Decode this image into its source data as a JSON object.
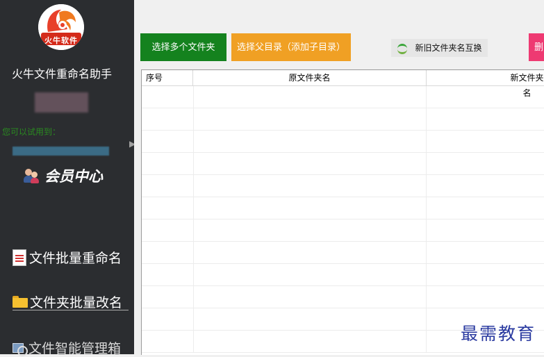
{
  "sidebar": {
    "logo_text": "火牛软件",
    "app_title": "火牛文件重命名助手",
    "trial_label": "您可以试用到：",
    "member_center": "会员中心",
    "nav": [
      {
        "label": "文件批量重命名",
        "icon": "document-icon"
      },
      {
        "label": "文件夹批量改名",
        "icon": "folder-icon",
        "active": true
      },
      {
        "label": "文件智能管理箱",
        "icon": "file-manager-icon"
      }
    ]
  },
  "toolbar": {
    "select_multiple_folders": "选择多个文件夹",
    "select_parent_dir": "选择父目录（添加子目录）",
    "swap_names": "新旧文件夹名互换",
    "pink_button": "删"
  },
  "table": {
    "columns": [
      "序号",
      "原文件夹名",
      "新文件夹名"
    ],
    "rows": []
  },
  "watermark": "最需教育",
  "colors": {
    "sidebar_bg": "#2b2d30",
    "green_button": "#14821e",
    "orange_button": "#f0a024",
    "pink_button": "#ee3a72",
    "trial_text": "#2a8a20"
  }
}
